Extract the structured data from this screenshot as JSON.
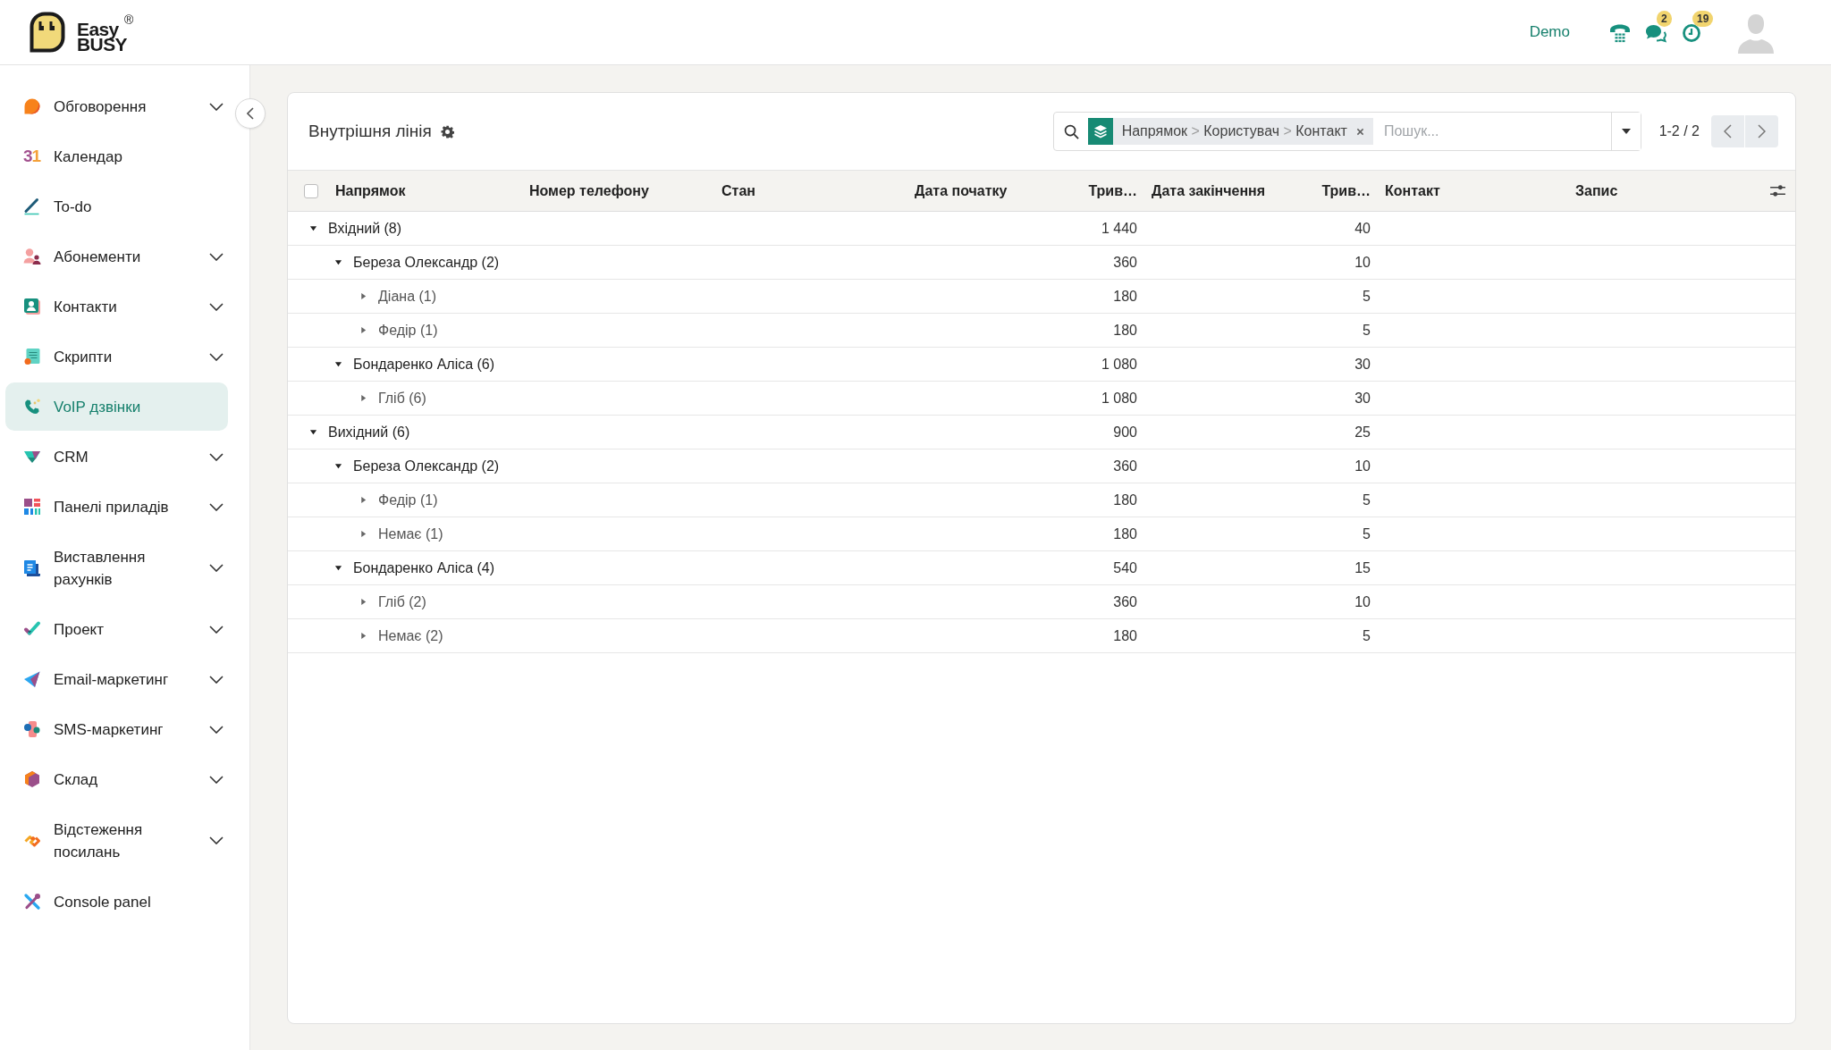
{
  "header": {
    "logo": {
      "words": [
        "Easy",
        "BUSY"
      ],
      "mark": "®"
    },
    "company": "Demo",
    "icons": [
      {
        "kind": "dialer"
      },
      {
        "kind": "messages",
        "badge": "2"
      },
      {
        "kind": "activities",
        "badge": "19"
      }
    ]
  },
  "sidebar": {
    "items": [
      {
        "label": "Обговорення",
        "submenu": true,
        "selected": false
      },
      {
        "label": "Календар",
        "icon_text": "31",
        "submenu": false,
        "selected": false
      },
      {
        "label": "To-do",
        "submenu": false,
        "selected": false
      },
      {
        "label": "Абонементи",
        "submenu": true,
        "selected": false
      },
      {
        "label": "Контакти",
        "submenu": true,
        "selected": false
      },
      {
        "label": "Скрипти",
        "submenu": true,
        "selected": false
      },
      {
        "label": "VoIP дзвінки",
        "submenu": false,
        "selected": true
      },
      {
        "label": "CRM",
        "submenu": true,
        "selected": false
      },
      {
        "label": "Панелі приладів",
        "submenu": true,
        "selected": false
      },
      {
        "label": "Виставлення рахунків",
        "submenu": true,
        "selected": false
      },
      {
        "label": "Проект",
        "submenu": true,
        "selected": false
      },
      {
        "label": "Email-маркетинг",
        "submenu": true,
        "selected": false
      },
      {
        "label": "SMS-маркетинг",
        "submenu": true,
        "selected": false
      },
      {
        "label": "Склад",
        "submenu": true,
        "selected": false
      },
      {
        "label": "Відстеження посилань",
        "submenu": true,
        "selected": false
      },
      {
        "label": "Console panel",
        "submenu": false,
        "selected": false
      }
    ]
  },
  "view": {
    "title": "Внутрішня лінія",
    "search": {
      "facet": {
        "groups": [
          "Напрямок",
          "Користувач",
          "Контакт"
        ],
        "separator": ">"
      },
      "placeholder": "Пошук..."
    },
    "pager": "1-2 / 2"
  },
  "table": {
    "select_all": {
      "checked": false
    },
    "columns": [
      {
        "label": "Напрямок",
        "numeric": false
      },
      {
        "label": "Номер телефону",
        "numeric": false
      },
      {
        "label": "Стан",
        "numeric": false
      },
      {
        "label": "Дата початку",
        "numeric": false
      },
      {
        "label": "Трив…",
        "numeric": true
      },
      {
        "label": "Дата закінчення",
        "numeric": false
      },
      {
        "label": "Трив…",
        "numeric": true
      },
      {
        "label": "Контакт",
        "numeric": false
      },
      {
        "label": "Запис",
        "numeric": false
      }
    ],
    "rows": [
      {
        "label": "Вхідний (8)",
        "column_5": "1 440",
        "column_7": "40",
        "expanded": true,
        "children": [
          {
            "label": "Береза Олександр (2)",
            "column_5": "360",
            "column_7": "10",
            "expanded": true,
            "children": [
              {
                "label": "Діана (1)",
                "column_5": "180",
                "column_7": "5",
                "expanded": false
              },
              {
                "label": "Федір (1)",
                "column_5": "180",
                "column_7": "5",
                "expanded": false
              }
            ]
          },
          {
            "label": "Бондаренко Аліса (6)",
            "column_5": "1 080",
            "column_7": "30",
            "expanded": true,
            "children": [
              {
                "label": "Гліб (6)",
                "column_5": "1 080",
                "column_7": "30",
                "expanded": false
              }
            ]
          }
        ]
      },
      {
        "label": "Вихідний (6)",
        "column_5": "900",
        "column_7": "25",
        "expanded": true,
        "children": [
          {
            "label": "Береза Олександр (2)",
            "column_5": "360",
            "column_7": "10",
            "expanded": true,
            "children": [
              {
                "label": "Федір (1)",
                "column_5": "180",
                "column_7": "5",
                "expanded": false
              },
              {
                "label": "Немає (1)",
                "column_5": "180",
                "column_7": "5",
                "expanded": false
              }
            ]
          },
          {
            "label": "Бондаренко Аліса (4)",
            "column_5": "540",
            "column_7": "15",
            "expanded": true,
            "children": [
              {
                "label": "Гліб (2)",
                "column_5": "360",
                "column_7": "10",
                "expanded": false
              },
              {
                "label": "Немає (2)",
                "column_5": "180",
                "column_7": "5",
                "expanded": false
              }
            ]
          }
        ]
      }
    ]
  }
}
